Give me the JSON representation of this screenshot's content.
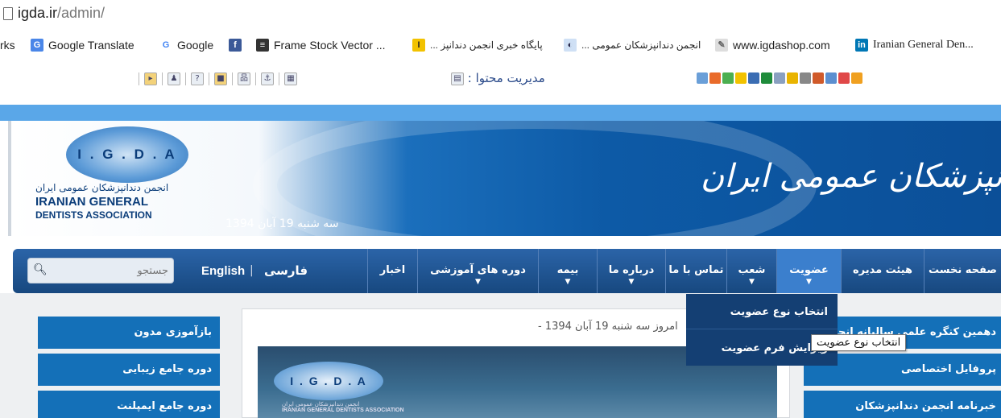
{
  "browser": {
    "url_host": "igda.ir",
    "url_path": "/admin/"
  },
  "bookmarks": [
    {
      "label": "rks",
      "icon": "none"
    },
    {
      "label": "Google Translate",
      "icon": "google-translate-icon"
    },
    {
      "label": "Google",
      "icon": "google-icon"
    },
    {
      "label": "",
      "icon": "facebook-icon"
    },
    {
      "label": "Frame Stock Vector ...",
      "icon": "frame-icon"
    },
    {
      "label": "پایگاه خبری انجمن دندانپز ...",
      "icon": "news-icon"
    },
    {
      "label": "انجمن دندانپزشکان عمومی ...",
      "icon": "igda-icon"
    },
    {
      "label": "www.igdashop.com",
      "icon": "shop-icon"
    },
    {
      "label": "Iranian General Den...",
      "icon": "linkedin-icon"
    }
  ],
  "toolbar": {
    "cms_label": "مدیریت محتوا :"
  },
  "header": {
    "logo_abbr": "I . G . D . A",
    "logo_fa": "انجمن دندانپزشکان عمومی ایران",
    "logo_en_1": "IRANIAN GENERAL",
    "logo_en_2": "DENTISTS ASSOCIATION",
    "date": "سه شنبه 19 آبان 1394",
    "title": "انجمن دندانپزشکان عمومی ایران"
  },
  "nav": {
    "items": [
      {
        "label": "صفحه نخست",
        "has_dropdown": false
      },
      {
        "label": "هیئت مدیره",
        "has_dropdown": false
      },
      {
        "label": "عضویت",
        "has_dropdown": true
      },
      {
        "label": "شعب",
        "has_dropdown": true
      },
      {
        "label": "تماس با ما",
        "has_dropdown": false
      },
      {
        "label": "درباره ما",
        "has_dropdown": true
      },
      {
        "label": "بیمه",
        "has_dropdown": true
      },
      {
        "label": "دوره های آموزشی",
        "has_dropdown": true
      },
      {
        "label": "اخبار",
        "has_dropdown": false
      }
    ],
    "lang_fa": "فارسی",
    "lang_sep": "|",
    "lang_en": "English",
    "search_placeholder": "جستجو"
  },
  "dropdown": {
    "items": [
      "انتخاب نوع عضویت",
      "ویرایش فرم عضویت"
    ],
    "tooltip": "انتخاب نوع عضویت"
  },
  "left_boxes": [
    "بازآموزی مدون",
    "دوره جامع زیبایی",
    "دوره جامع ایمپلنت"
  ],
  "right_boxes": [
    "دهمین کنگره علمی سالیانه انجمن",
    "پروفایل اختصاصی",
    "خبرنامه انجمن دندانپزشکان"
  ],
  "main": {
    "today": "امروز سه شنبه 19 آبان 1394 -",
    "banner_logo": "I . G . D . A",
    "banner_fa": "انجمن دندانپزشکان عمومی ایران",
    "banner_en": "IRANIAN GENERAL DENTISTS ASSOCIATION"
  }
}
